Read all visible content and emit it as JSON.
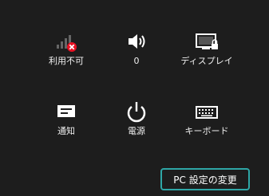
{
  "settings_pane": {
    "tiles": [
      {
        "id": "network",
        "label": "利用不可",
        "icon": "network-unavailable-icon"
      },
      {
        "id": "volume",
        "label": "0",
        "icon": "speaker-icon"
      },
      {
        "id": "display",
        "label": "ディスプレイ",
        "icon": "display-icon"
      },
      {
        "id": "notifications",
        "label": "通知",
        "icon": "notification-icon"
      },
      {
        "id": "power",
        "label": "電源",
        "icon": "power-icon"
      },
      {
        "id": "keyboard",
        "label": "キーボード",
        "icon": "keyboard-icon"
      }
    ],
    "pc_settings_link": "PC 設定の変更",
    "colors": {
      "background": "#1d1d1d",
      "highlight_border": "#2ea7a7",
      "error_badge": "#e81123"
    }
  }
}
